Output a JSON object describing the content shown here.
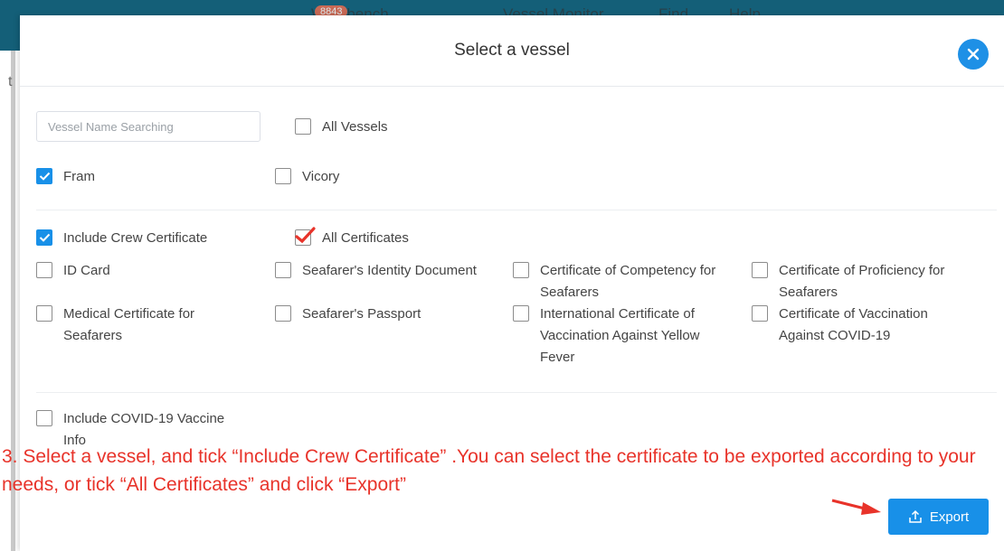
{
  "background": {
    "nav": [
      {
        "label": "Workbench",
        "badge": "8843"
      },
      {
        "label": "Vessel Monitor"
      },
      {
        "label": "Find"
      },
      {
        "label": "Help"
      }
    ]
  },
  "dialog": {
    "title": "Select a vessel",
    "search": {
      "placeholder": "Vessel Name Searching",
      "value": ""
    },
    "vessels": {
      "all": {
        "label": "All Vessels",
        "checked": false
      },
      "items": [
        {
          "label": "Fram",
          "checked": true
        },
        {
          "label": "Vicory",
          "checked": false
        }
      ]
    },
    "include_crew_certificate": {
      "label": "Include Crew Certificate",
      "checked": true
    },
    "all_certificates": {
      "label": "All Certificates",
      "checked": true
    },
    "certificates": [
      {
        "label": "ID Card",
        "checked": false
      },
      {
        "label": "Seafarer's Identity Document",
        "checked": false
      },
      {
        "label": "Certificate of Competency for Seafarers",
        "checked": false
      },
      {
        "label": "Certificate of Proficiency for Seafarers",
        "checked": false
      },
      {
        "label": "Medical Certificate for Seafarers",
        "checked": false
      },
      {
        "label": "Seafarer's Passport",
        "checked": false
      },
      {
        "label": "International Certificate of Vaccination Against Yellow Fever",
        "checked": false
      },
      {
        "label": "Certificate of Vaccination Against COVID-19",
        "checked": false
      }
    ],
    "include_covid": {
      "label": "Include COVID-19 Vaccine Info",
      "checked": false
    },
    "export_label": "Export"
  },
  "annotation": {
    "text": "3. Select a vessel, and tick “Include Crew Certificate” .You can select the certificate to be exported according to your needs, or tick “All Certificates” and click “Export”"
  },
  "colors": {
    "accent": "#1890e8",
    "annotation": "#e8332a",
    "topbar": "#145f78"
  }
}
